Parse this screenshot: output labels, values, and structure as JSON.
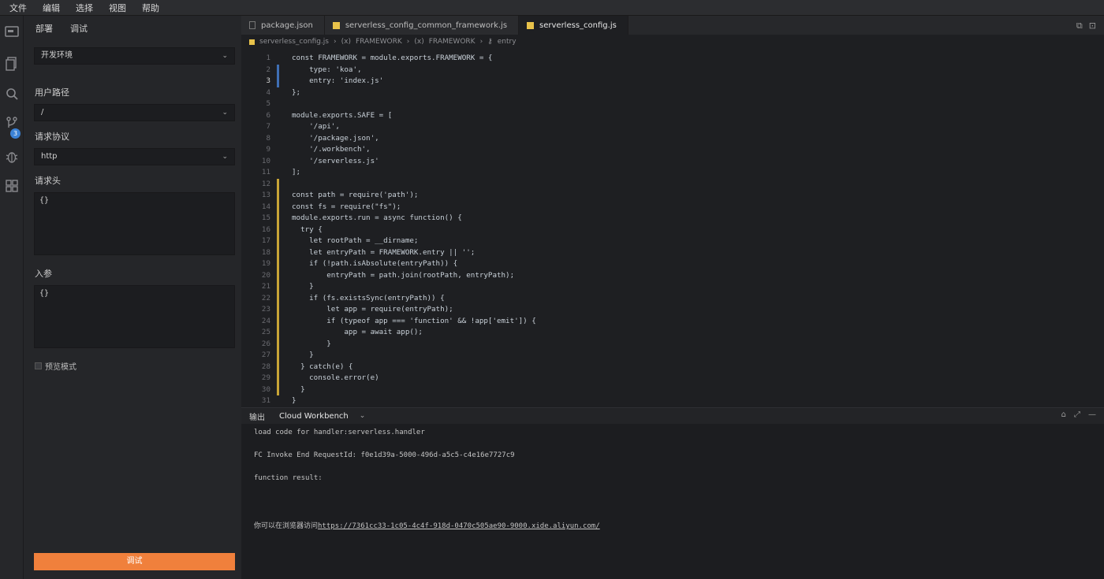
{
  "menu": [
    "文件",
    "编辑",
    "选择",
    "视图",
    "帮助"
  ],
  "activity": {
    "scm_badge": "3"
  },
  "sidebar": {
    "tabs": [
      "部署",
      "调试"
    ],
    "env_select": "开发环境",
    "path_label": "用户路径",
    "path_value": "/",
    "protocol_label": "请求协议",
    "protocol_value": "http",
    "headers_label": "请求头",
    "headers_value": "{}",
    "params_label": "入参",
    "params_value": "{}",
    "mode_label": "预览模式",
    "run_button": "调试"
  },
  "tabs": [
    {
      "label": "package.json",
      "type": "file"
    },
    {
      "label": "serverless_config_common_framework.js",
      "type": "js"
    },
    {
      "label": "serverless_config.js",
      "type": "js"
    }
  ],
  "breadcrumb": [
    "serverless_config.js",
    "FRAMEWORK",
    "FRAMEWORK",
    "entry"
  ],
  "code": {
    "current_line": 3,
    "lines": [
      "const FRAMEWORK = module.exports.FRAMEWORK = {",
      "    type: 'koa',",
      "    entry: 'index.js'",
      "};",
      "",
      "module.exports.SAFE = [",
      "    '/api',",
      "    '/package.json',",
      "    '/.workbench',",
      "    '/serverless.js'",
      "];",
      "",
      "const path = require('path');",
      "const fs = require(\"fs\");",
      "module.exports.run = async function() {",
      "  try {",
      "    let rootPath = __dirname;",
      "    let entryPath = FRAMEWORK.entry || '';",
      "    if (!path.isAbsolute(entryPath)) {",
      "        entryPath = path.join(rootPath, entryPath);",
      "    }",
      "    if (fs.existsSync(entryPath)) {",
      "        let app = require(entryPath);",
      "        if (typeof app === 'function' && !app['emit']) {",
      "            app = await app();",
      "        }",
      "    }",
      "  } catch(e) {",
      "    console.error(e)",
      "  }",
      "}"
    ]
  },
  "panel": {
    "tab_output": "输出",
    "tab_channel": "Cloud Workbench",
    "output": {
      "line1": "load code for handler:serverless.handler",
      "line2": "FC Invoke End RequestId: f0e1d39a-5000-496d-a5c5-c4e16e7727c9",
      "line3": "function result:",
      "visit_prefix": "你可以在浏览器访问",
      "visit_url": "https://7361cc33-1c05-4c4f-918d-0470c505ae90-9000.xide.aliyun.com/"
    }
  }
}
